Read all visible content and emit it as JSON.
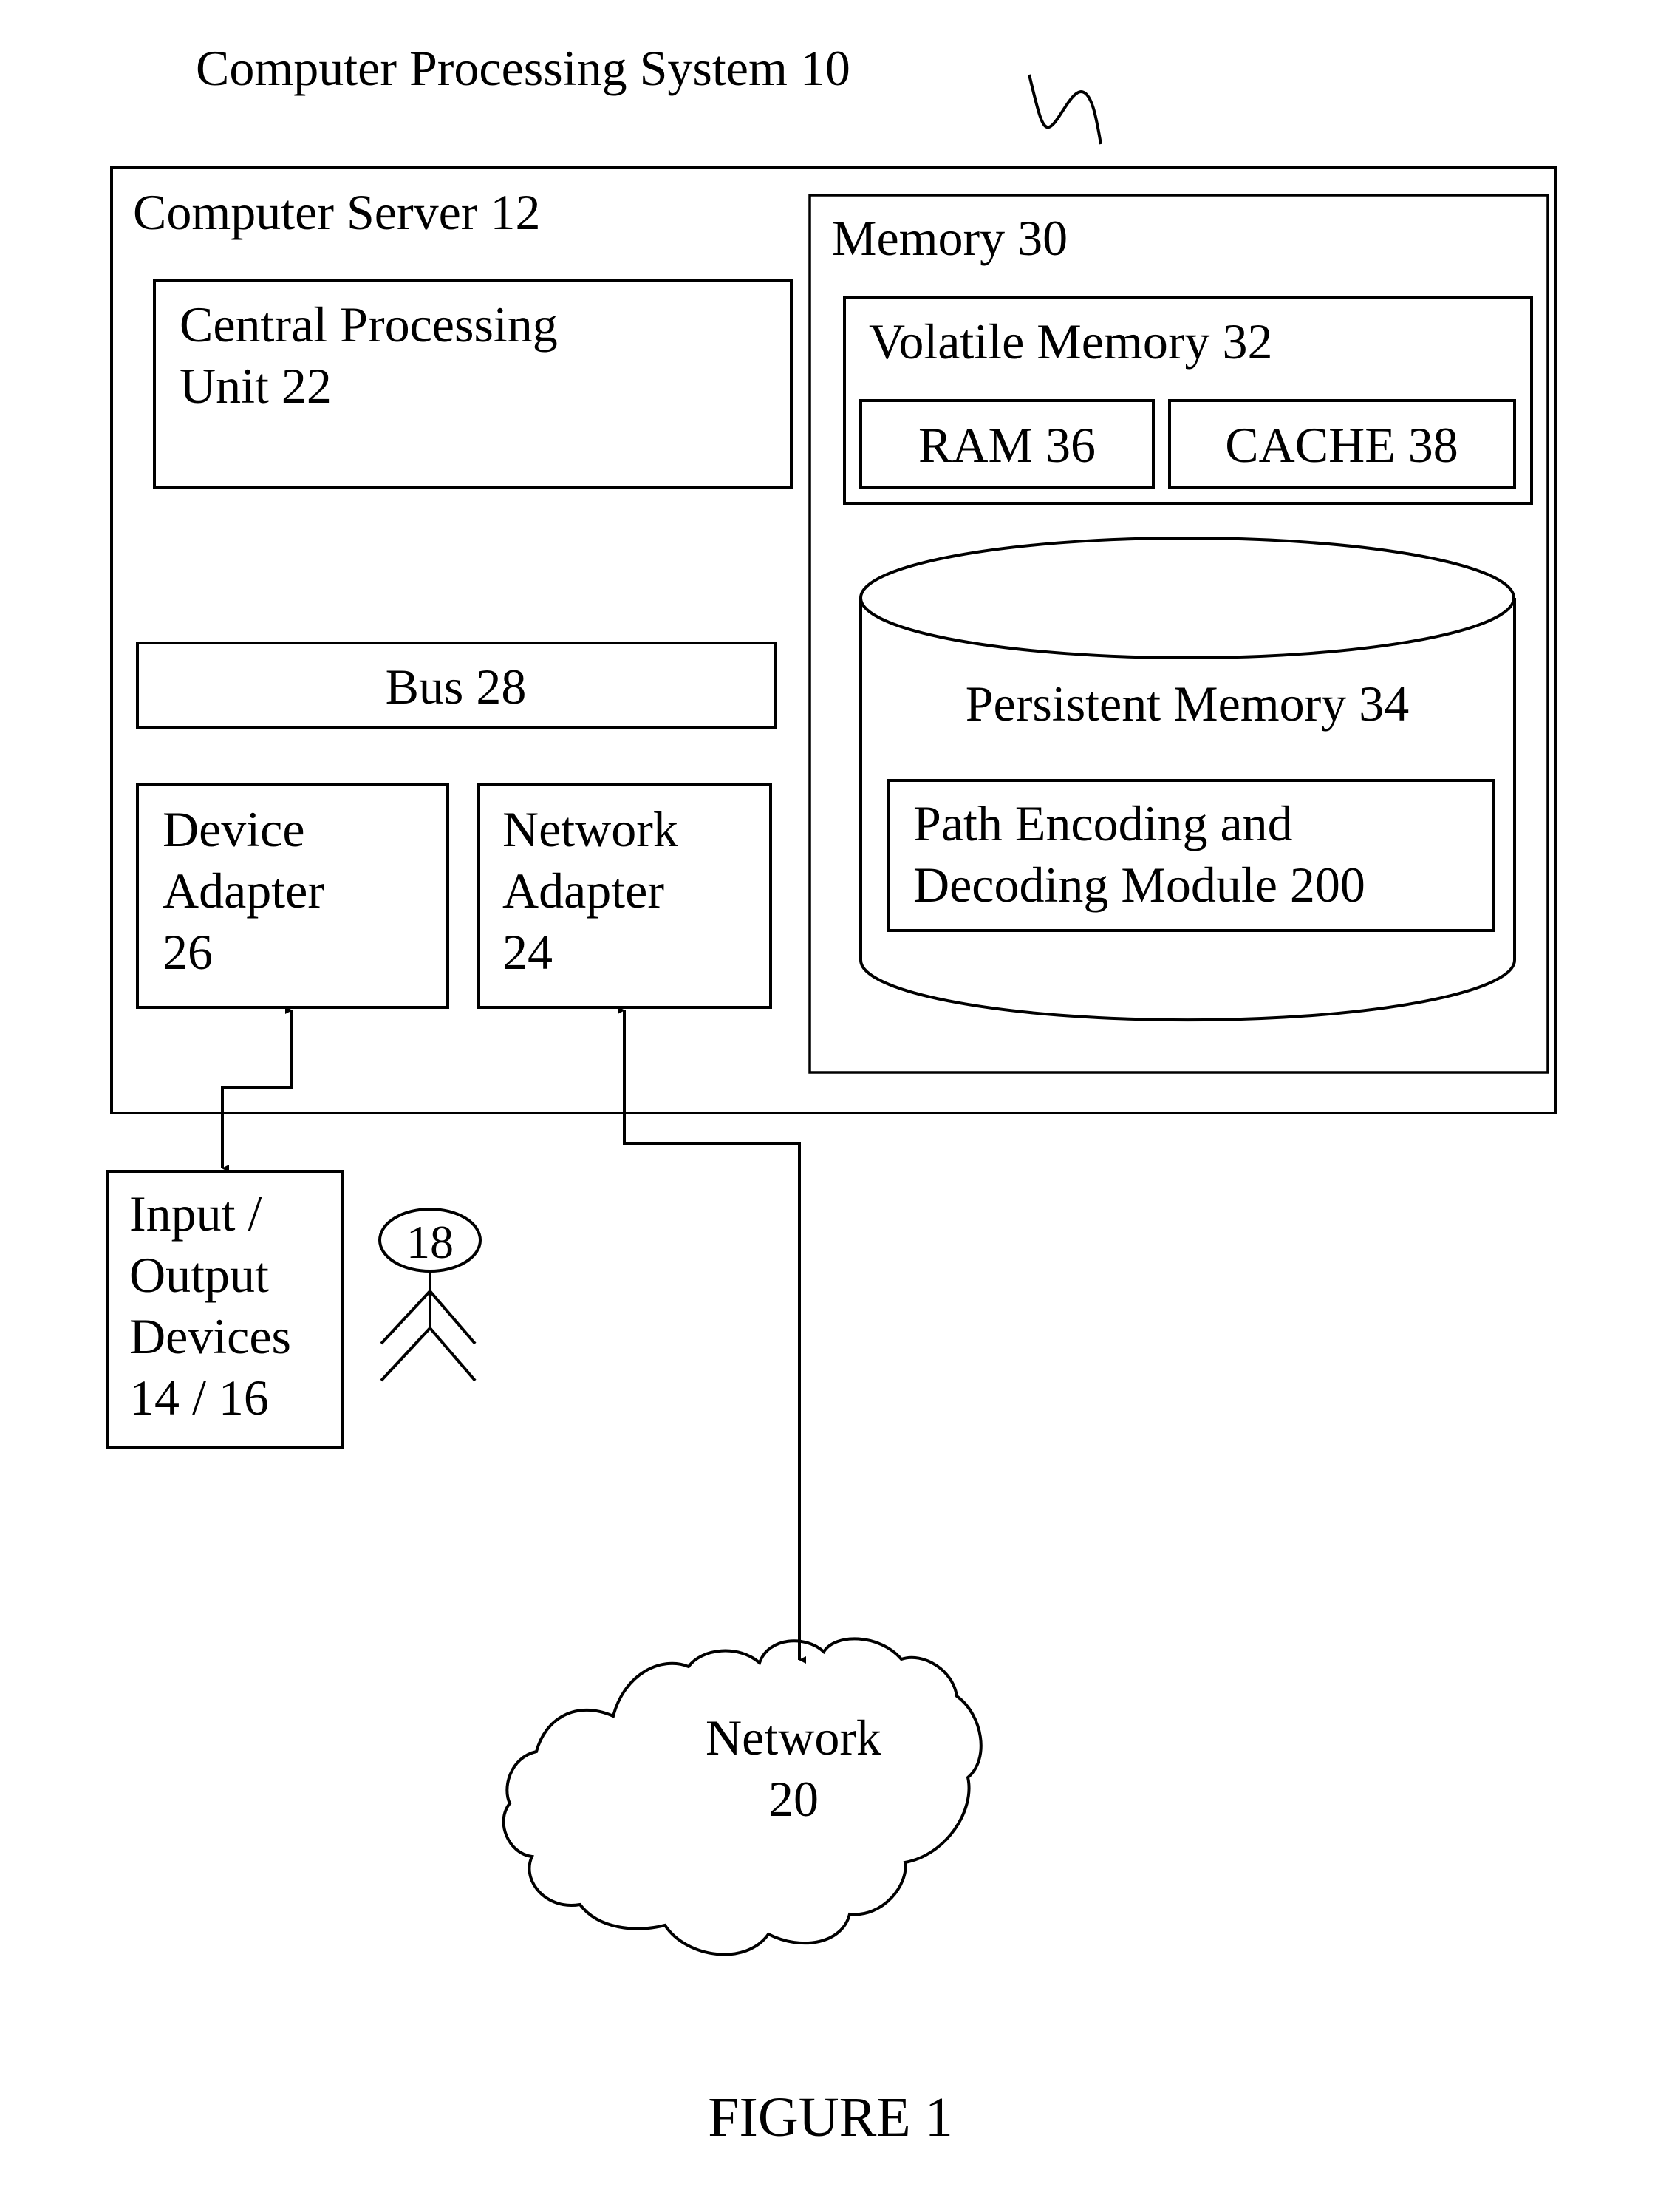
{
  "system": {
    "title": "Computer Processing System 10"
  },
  "server": {
    "title": "Computer Server 12",
    "cpu": {
      "line1": "Central Processing",
      "line2": "Unit 22"
    },
    "bus": "Bus 28",
    "device_adapter": {
      "line1": "Device",
      "line2": "Adapter",
      "line3": "26"
    },
    "network_adapter": {
      "line1": "Network",
      "line2": "Adapter",
      "line3": "24"
    }
  },
  "memory": {
    "title": "Memory 30",
    "volatile": {
      "title": "Volatile Memory 32",
      "ram": "RAM 36",
      "cache": "CACHE 38"
    },
    "persistent": {
      "title": "Persistent Memory 34",
      "module": {
        "line1": "Path Encoding and",
        "line2": "Decoding Module 200"
      }
    }
  },
  "io_devices": {
    "line1": "Input /",
    "line2": "Output",
    "line3": "Devices",
    "line4": "14 / 16"
  },
  "user": {
    "label": "18"
  },
  "network": {
    "line1": "Network",
    "line2": "20"
  },
  "figure_caption": "FIGURE 1"
}
